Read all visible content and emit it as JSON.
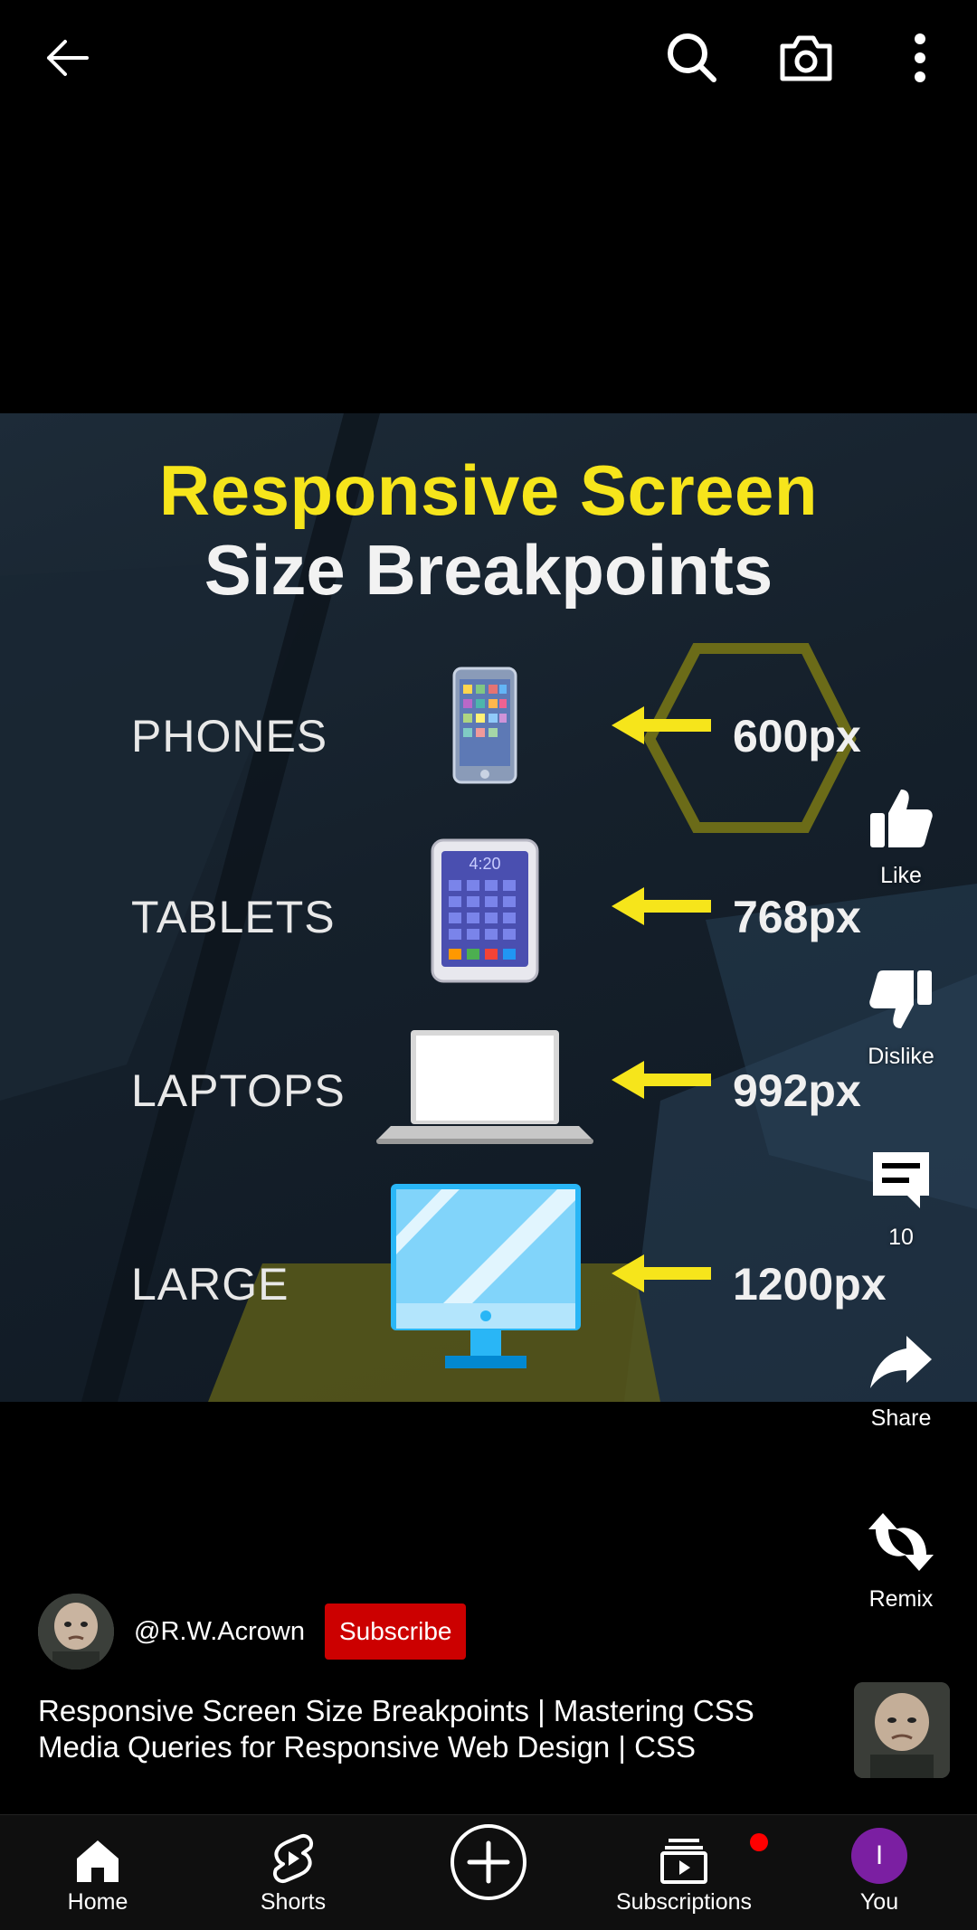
{
  "topbar": {
    "back_icon": "arrow-left-icon",
    "search_icon": "search-icon",
    "camera_icon": "camera-icon",
    "more_icon": "more-vertical-icon"
  },
  "video": {
    "title_line1": "Responsive Screen",
    "title_line2": "Size Breakpoints",
    "rows": [
      {
        "label": "PHONES",
        "value": "600px",
        "device": "phone-icon"
      },
      {
        "label": "TABLETS",
        "value": "768px",
        "device": "tablet-icon"
      },
      {
        "label": "LAPTOPS",
        "value": "992px",
        "device": "laptop-icon"
      },
      {
        "label": "LARGE",
        "value": "1200px",
        "device": "monitor-icon"
      }
    ],
    "tablet_clock": "4:20",
    "accent_yellow": "#f6e51b"
  },
  "rail": {
    "like_label": "Like",
    "dislike_label": "Dislike",
    "comments_count": "10",
    "share_label": "Share",
    "remix_label": "Remix"
  },
  "channel": {
    "handle": "@R.W.Acrown",
    "subscribe_label": "Subscribe",
    "subscribe_color": "#cc0000"
  },
  "video_title": "Responsive Screen Size Breakpoints  | Mastering CSS Media Queries for Responsive Web Design | CSS",
  "nav": {
    "home": "Home",
    "shorts": "Shorts",
    "create_icon": "plus-circle-icon",
    "subscriptions": "Subscriptions",
    "you": "You",
    "you_initial": "I",
    "you_avatar_color": "#7b1fa2"
  }
}
